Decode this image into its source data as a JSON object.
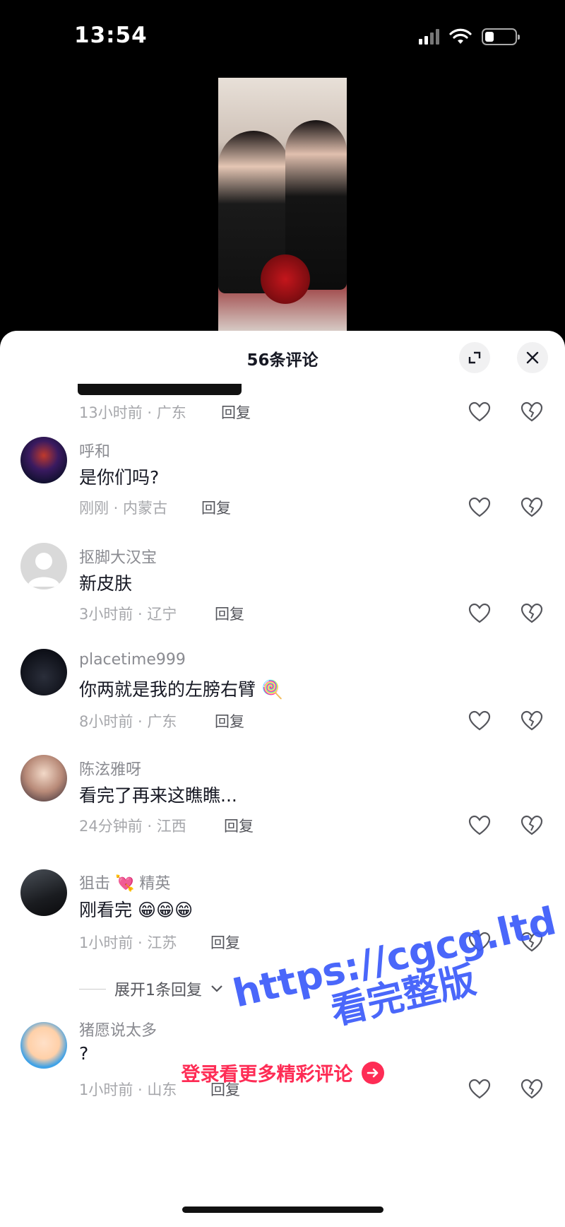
{
  "status": {
    "time": "13:54"
  },
  "sheet": {
    "title": "56条评论"
  },
  "comments": [
    {
      "meta": "13小时前 · 广东",
      "reply": "回复"
    },
    {
      "username": "呼和",
      "text": "是你们吗?",
      "meta": "刚刚 · 内蒙古",
      "reply": "回复"
    },
    {
      "username": "抠脚大汉宝",
      "text": "新皮肤",
      "meta": "3小时前 · 辽宁",
      "reply": "回复"
    },
    {
      "username": "placetime999",
      "text": "你两就是我的左膀右臂",
      "meta": "8小时前 · 广东",
      "reply": "回复",
      "emoji": "🍭"
    },
    {
      "username": "陈泫雅呀",
      "text": "看完了再来这瞧瞧...",
      "meta": "24分钟前 · 江西",
      "reply": "回复"
    },
    {
      "username_a": "狙击",
      "username_emoji": "💘",
      "username_b": "精英",
      "text": "刚看完",
      "emoji": "😁😁😁",
      "meta": "1小时前 · 江苏",
      "reply": "回复"
    },
    {
      "username": "猪愿说太多",
      "text": "?",
      "meta": "1小时前 · 山东",
      "reply": "回复"
    }
  ],
  "expand_replies": "展开1条回复",
  "login_more": "登录看更多精彩评论",
  "watermark": {
    "url": "https://cgcg.ltd",
    "sub": "看完整版"
  },
  "colors": {
    "accent": "#fe2c55",
    "watermark": "#3b5bfa",
    "text": "#161823",
    "muted": "#8a8b91"
  }
}
